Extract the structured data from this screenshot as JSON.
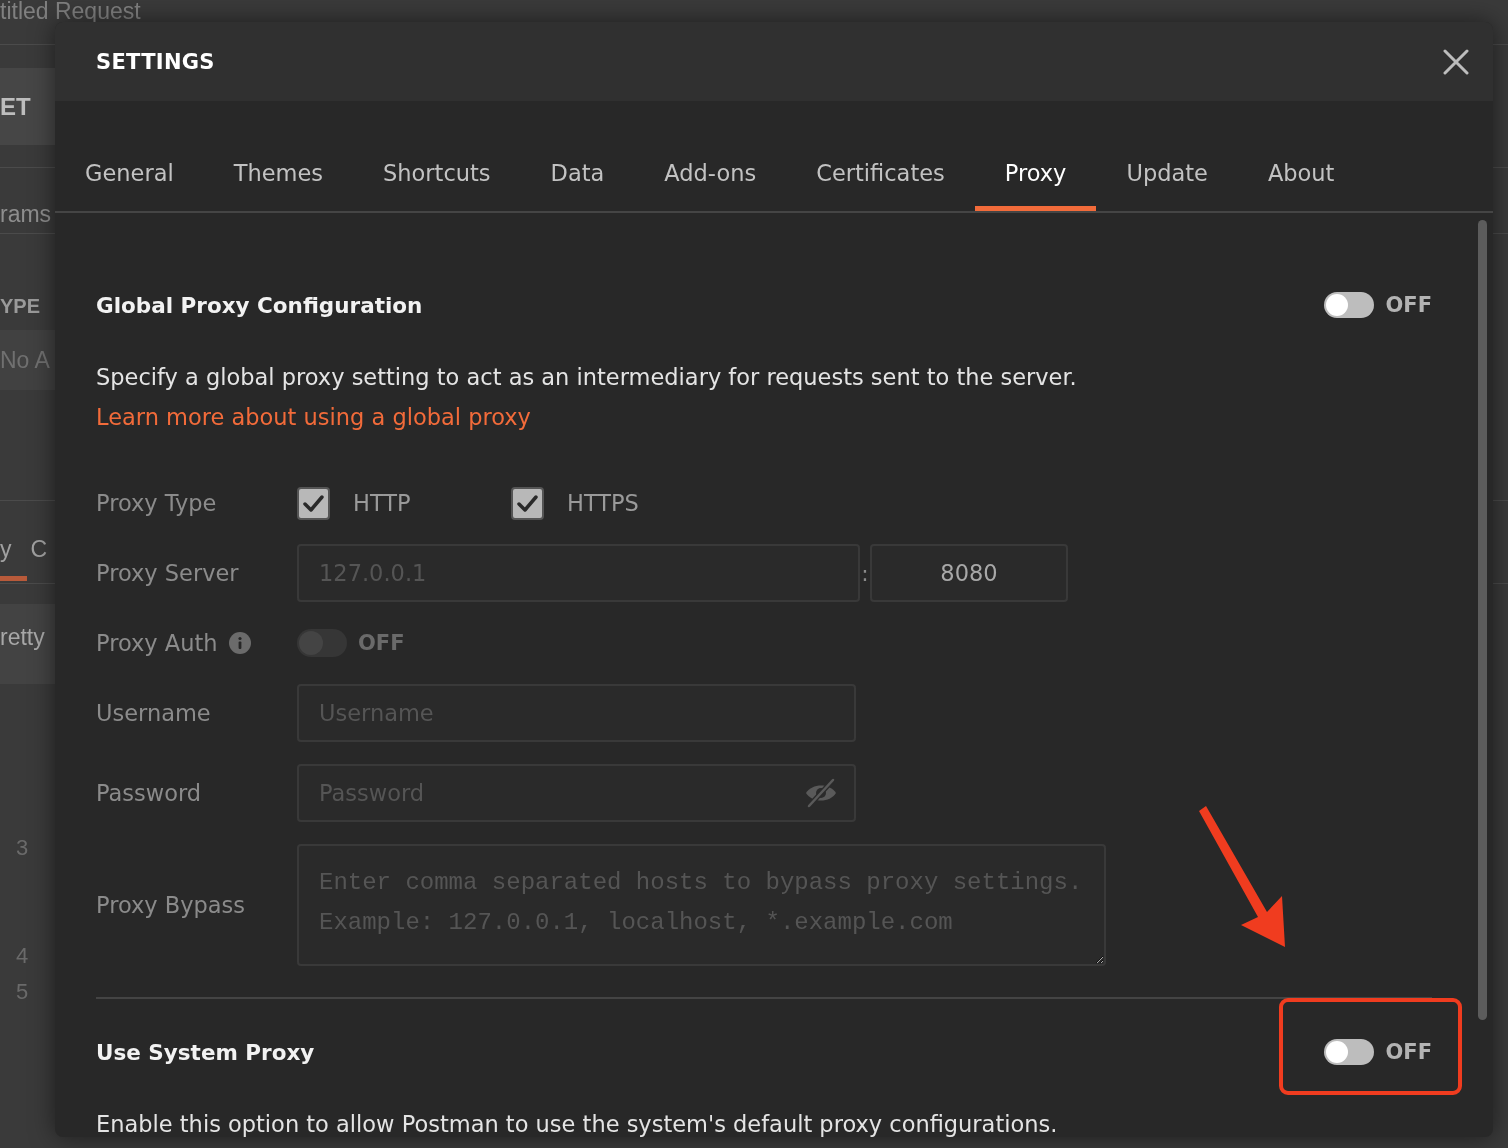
{
  "background": {
    "title": "titled Request",
    "method": "ET",
    "tab": "rams",
    "type_label": "YPE",
    "auth_value": "No A",
    "body_tabs": [
      {
        "label": "y",
        "selected": true
      },
      {
        "label": "C",
        "selected": false
      }
    ],
    "view_mode": "retty",
    "line_numbers": [
      "3",
      "4",
      "5"
    ]
  },
  "dialog": {
    "title": "SETTINGS"
  },
  "tabs": [
    {
      "label": "General",
      "selected": false
    },
    {
      "label": "Themes",
      "selected": false
    },
    {
      "label": "Shortcuts",
      "selected": false
    },
    {
      "label": "Data",
      "selected": false
    },
    {
      "label": "Add-ons",
      "selected": false
    },
    {
      "label": "Certificates",
      "selected": false
    },
    {
      "label": "Proxy",
      "selected": true
    },
    {
      "label": "Update",
      "selected": false
    },
    {
      "label": "About",
      "selected": false
    }
  ],
  "global_proxy": {
    "title": "Global Proxy Configuration",
    "on": false,
    "state_label": "OFF",
    "description": "Specify a global proxy setting to act as an intermediary for requests sent to the server.",
    "link": "Learn more about using a global proxy",
    "proxy_type": {
      "label": "Proxy Type",
      "options": [
        {
          "label": "HTTP",
          "checked": true
        },
        {
          "label": "HTTPS",
          "checked": true
        }
      ]
    },
    "proxy_server": {
      "label": "Proxy Server",
      "host_placeholder": "127.0.0.1",
      "separator": ":",
      "port": "8080"
    },
    "proxy_auth": {
      "label": "Proxy Auth",
      "on": false,
      "disabled": true,
      "state_label": "OFF"
    },
    "username": {
      "label": "Username",
      "placeholder": "Username"
    },
    "password": {
      "label": "Password",
      "placeholder": "Password"
    },
    "proxy_bypass": {
      "label": "Proxy Bypass",
      "placeholder": "Enter comma separated hosts to bypass proxy settings.\nExample: 127.0.0.1, localhost, *.example.com"
    }
  },
  "system_proxy": {
    "title": "Use System Proxy",
    "on": false,
    "state_label": "OFF",
    "description": "Enable this option to allow Postman to use the system's default proxy configurations."
  }
}
